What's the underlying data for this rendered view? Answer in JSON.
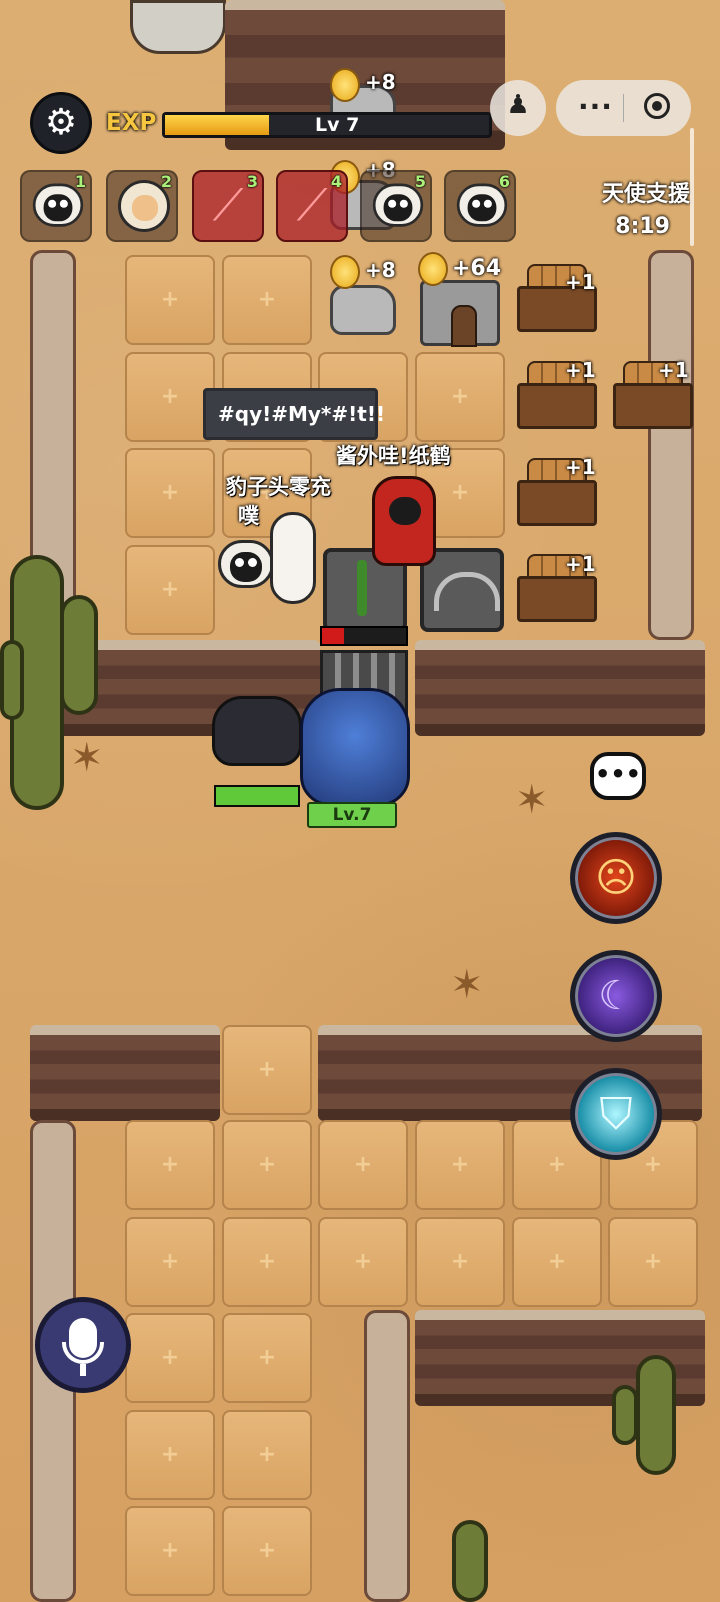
{
  "hud": {
    "exp_label": "EXP",
    "level_label": "Lv 7",
    "exp_progress": 0.32,
    "angel_support_title": "天使支援",
    "angel_support_timer": "8:19"
  },
  "party_slots": [
    {
      "num": "1",
      "kind": "sheep-black"
    },
    {
      "num": "2",
      "kind": "sheep-tan"
    },
    {
      "num": "3",
      "kind": "claw-red"
    },
    {
      "num": "4",
      "kind": "claw-red"
    },
    {
      "num": "5",
      "kind": "sheep-black"
    },
    {
      "num": "6",
      "kind": "sheep-black"
    }
  ],
  "resources": {
    "rock1_bonus": "+8",
    "rock2_bonus": "+8",
    "rock3_bonus": "+8",
    "house_bonus": "+64",
    "crate1_bonus": "+1",
    "crate2_bonus": "+1",
    "crate3_bonus": "+1",
    "crate4_bonus": "+1",
    "crate5_bonus": "+1"
  },
  "players": {
    "chat_bubble": "#qy!#My*#!t!!",
    "player1_name_line1": "豹子头零充",
    "player1_name_line2": "噗",
    "player2_name": "酱外哇!纸鹤"
  },
  "boss": {
    "level": "Lv.7",
    "health_fraction": 0.75
  },
  "colors": {
    "exp_fill": "#f2b01e",
    "hp_green": "#5fc93a",
    "level_badge": "#6fd04c",
    "danger_red": "#d11a1a"
  }
}
